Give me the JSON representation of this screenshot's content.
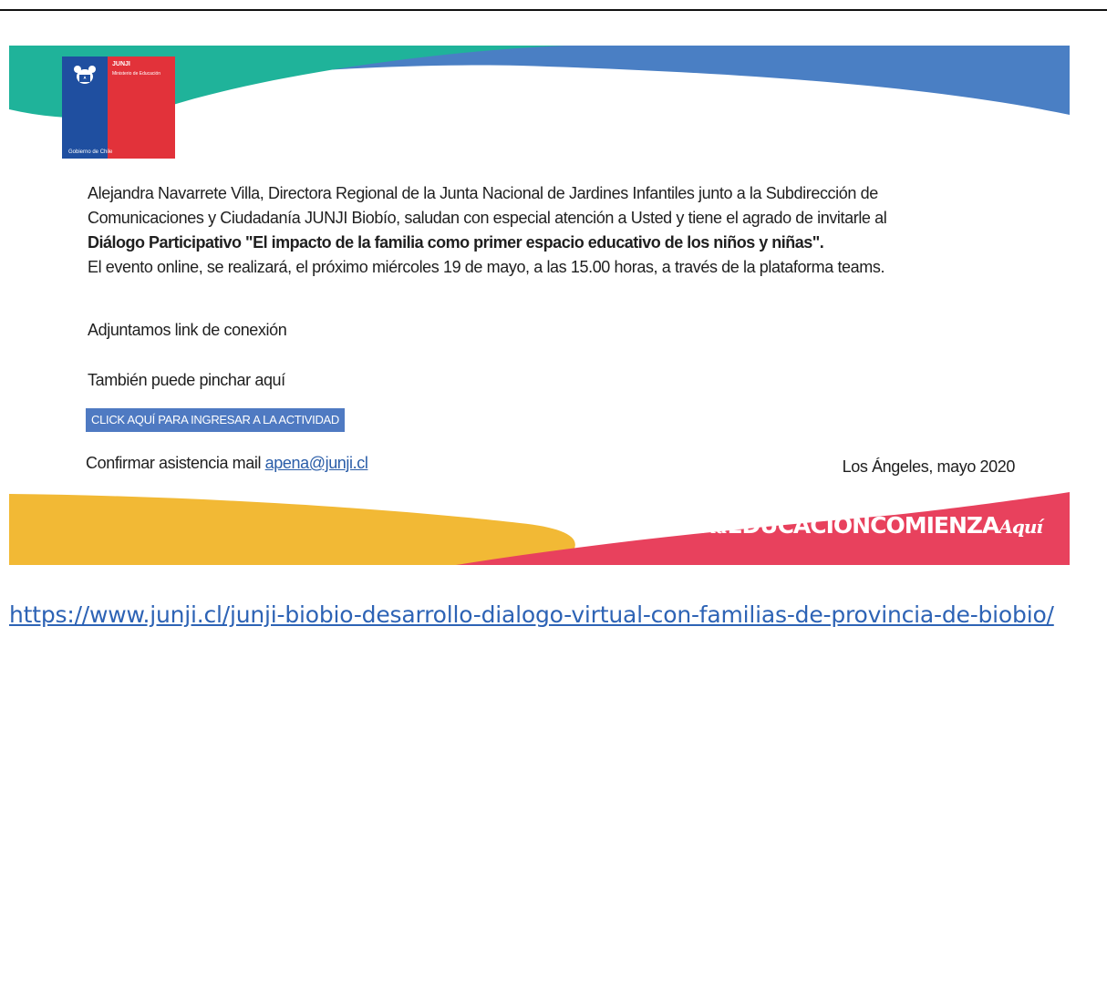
{
  "logo": {
    "brand": "JUNJI",
    "ministry": "Ministerio de Educación",
    "government": "Gobierno de Chile"
  },
  "invitation": {
    "line1": "Alejandra Navarrete Villa, Directora Regional de la Junta Nacional de Jardines Infantiles junto a la Subdirección de",
    "line2": "Comunicaciones y Ciudadanía JUNJI Biobío,  saludan con especial atención a Usted y tiene el agrado de invitarle al",
    "line3_bold": "Diálogo Participativo \"El impacto de la familia como primer espacio educativo de los niños y niñas\".",
    "line4": "El evento online, se realizará, el próximo miércoles 19 de mayo, a las 15.00 horas, a través de la plataforma teams."
  },
  "attachment_note": "Adjuntamos link de conexión",
  "also_note": "También puede pinchar aquí",
  "cta_button": "CLICK AQUÍ PARA INGRESAR A LA ACTIVIDAD",
  "confirm": {
    "label": "Confirmar asistencia mail",
    "email": "apena@junji.cl"
  },
  "place_date": "Los Ángeles, mayo 2020",
  "hashtag": {
    "prefix": "#",
    "la": "la",
    "main": "EDUCACIÓNCOMIENZA",
    "aqui": "Aquí"
  },
  "external_link": "https://www.junji.cl/junji-biobio-desarrollo-dialogo-virtual-con-familias-de-provincia-de-biobio/",
  "colors": {
    "teal": "#1fb39a",
    "blue": "#4a7fc4",
    "yellow": "#f2b935",
    "pink": "#e8415d",
    "logo_blue": "#1f4fa0",
    "logo_red": "#e2323a",
    "button": "#4f7ac2",
    "link": "#2d63b5"
  }
}
